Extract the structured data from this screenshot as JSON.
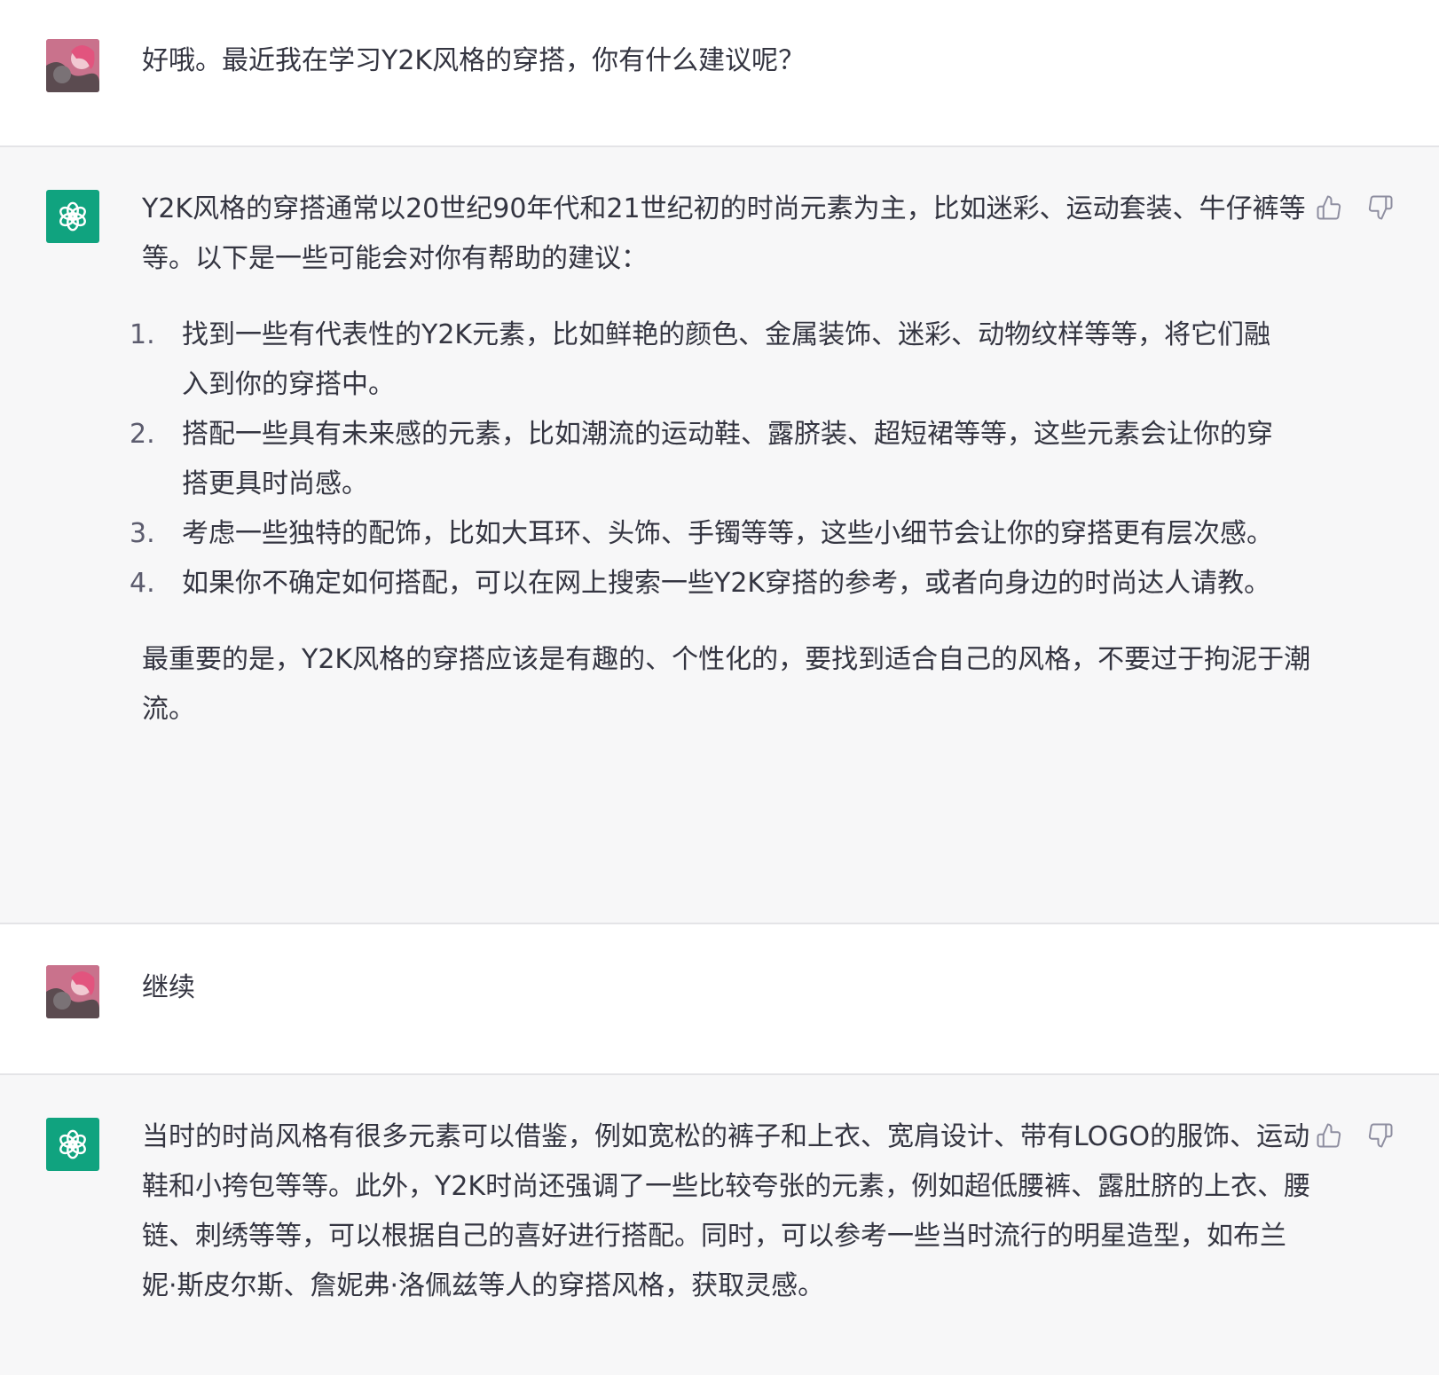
{
  "conversation": {
    "turns": [
      {
        "role": "user",
        "avatar_icon": "user-avatar",
        "text": "好哦。最近我在学习Y2K风格的穿搭，你有什么建议呢？"
      },
      {
        "role": "assistant",
        "avatar_icon": "openai-logo",
        "intro": "Y2K风格的穿搭通常以20世纪90年代和21世纪初的时尚元素为主，比如迷彩、运动套装、牛仔裤等等。以下是一些可能会对你有帮助的建议：",
        "list": [
          {
            "num": "1.",
            "text": "找到一些有代表性的Y2K元素，比如鲜艳的颜色、金属装饰、迷彩、动物纹样等等，将它们融入到你的穿搭中。"
          },
          {
            "num": "2.",
            "text": "搭配一些具有未来感的元素，比如潮流的运动鞋、露脐装、超短裙等等，这些元素会让你的穿搭更具时尚感。"
          },
          {
            "num": "3.",
            "text": "考虑一些独特的配饰，比如大耳环、头饰、手镯等等，这些小细节会让你的穿搭更有层次感。"
          },
          {
            "num": "4.",
            "text": "如果你不确定如何搭配，可以在网上搜索一些Y2K穿搭的参考，或者向身边的时尚达人请教。"
          }
        ],
        "outro": "最重要的是，Y2K风格的穿搭应该是有趣的、个性化的，要找到适合自己的风格，不要过于拘泥于潮流。"
      },
      {
        "role": "user",
        "avatar_icon": "user-avatar",
        "text": "继续"
      },
      {
        "role": "assistant",
        "avatar_icon": "openai-logo",
        "text": "当时的时尚风格有很多元素可以借鉴，例如宽松的裤子和上衣、宽肩设计、带有LOGO的服饰、运动鞋和小挎包等等。此外，Y2K时尚还强调了一些比较夸张的元素，例如超低腰裤、露肚脐的上衣、腰链、刺绣等等，可以根据自己的喜好进行搭配。同时，可以参考一些当时流行的明星造型，如布兰妮·斯皮尔斯、詹妮弗·洛佩兹等人的穿搭风格，获取灵感。"
      }
    ]
  },
  "colors": {
    "assistant_bg": "#f7f7f8",
    "user_bg": "#ffffff",
    "gpt_avatar": "#10a37f",
    "text": "#343541",
    "icon": "#8e8ea0"
  }
}
